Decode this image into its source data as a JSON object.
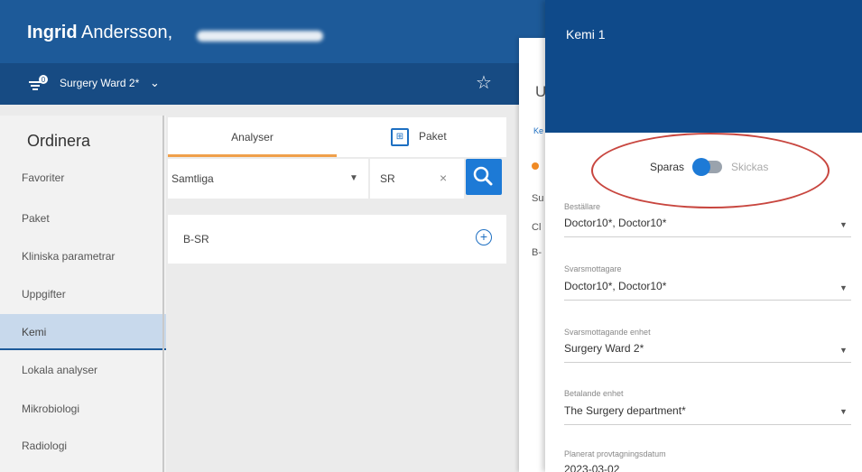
{
  "header": {
    "user_first": "Ingrid",
    "user_last": "Andersson,",
    "ward": "Surgery Ward 2*"
  },
  "nav": {
    "title": "Ordinera",
    "items": [
      {
        "label": "Favoriter"
      },
      {
        "label": "Paket"
      },
      {
        "label": "Kliniska parametrar"
      },
      {
        "label": "Uppgifter"
      },
      {
        "label": "Kemi"
      },
      {
        "label": "Lokala analyser"
      },
      {
        "label": "Mikrobiologi"
      },
      {
        "label": "Radiologi"
      }
    ],
    "active": "Kemi"
  },
  "tabs": {
    "analyser": "Analyser",
    "paket": "Paket"
  },
  "filter": {
    "value": "Samtliga"
  },
  "search": {
    "value": "SR"
  },
  "results": [
    {
      "label": "B-SR"
    }
  ],
  "background_panel": {
    "chars": [
      "U",
      "Ke",
      "Su",
      "Cl",
      "B-"
    ]
  },
  "drawer": {
    "title": "Kemi 1",
    "toggle": {
      "left": "Sparas",
      "right": "Skickas"
    },
    "fields": [
      {
        "label": "Beställare",
        "value": "Doctor10*, Doctor10*"
      },
      {
        "label": "Svarsmottagare",
        "value": "Doctor10*, Doctor10*"
      },
      {
        "label": "Svarsmottagande enhet",
        "value": "Surgery Ward 2*"
      },
      {
        "label": "Betalande enhet",
        "value": "The Surgery department*"
      },
      {
        "label": "Planerat provtagningsdatum",
        "value": "2023-03-02"
      }
    ]
  },
  "colors": {
    "header": "#1d5a99",
    "drawer_header": "#0f4a8a",
    "accent": "#1d7ad6",
    "tab_underline": "#f0a04b",
    "annotation": "#c8463f"
  }
}
